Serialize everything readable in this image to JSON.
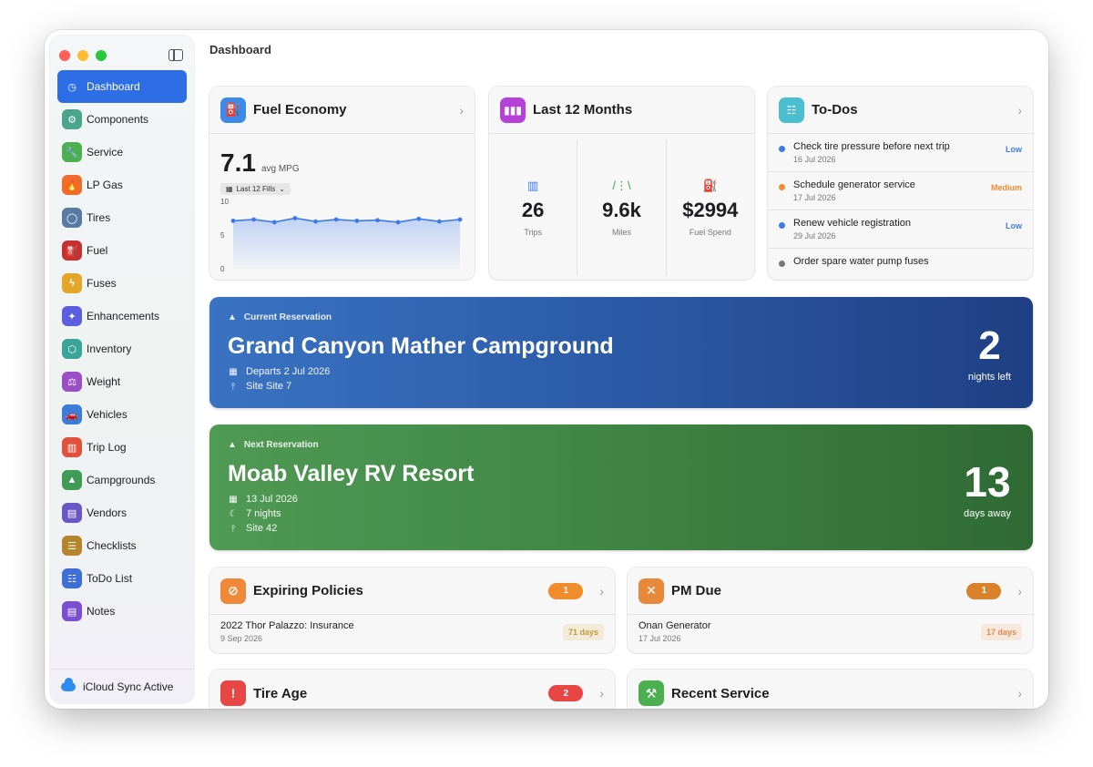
{
  "sidebar": {
    "items": [
      {
        "label": "Dashboard",
        "icon": "dashboard-icon",
        "color": "#2d6de6",
        "glyph": "◷"
      },
      {
        "label": "Components",
        "icon": "gear-icon",
        "color": "#4aa58c",
        "glyph": "⚙"
      },
      {
        "label": "Service",
        "icon": "wrench-icon",
        "color": "#4caf50",
        "glyph": "🔧"
      },
      {
        "label": "LP Gas",
        "icon": "flame-icon",
        "color": "#ef6c2b",
        "glyph": "🔥"
      },
      {
        "label": "Tires",
        "icon": "tire-icon",
        "color": "#5a7aa6",
        "glyph": "◯"
      },
      {
        "label": "Fuel",
        "icon": "fuel-pump-icon",
        "color": "#c53030",
        "glyph": "⛽"
      },
      {
        "label": "Fuses",
        "icon": "bolt-icon",
        "color": "#e3a62b",
        "glyph": "ϟ"
      },
      {
        "label": "Enhancements",
        "icon": "sparkles-icon",
        "color": "#5b5fdf",
        "glyph": "✦"
      },
      {
        "label": "Inventory",
        "icon": "box-icon",
        "color": "#3aa39a",
        "glyph": "⬡"
      },
      {
        "label": "Weight",
        "icon": "scale-icon",
        "color": "#9b4fc6",
        "glyph": "⚖"
      },
      {
        "label": "Vehicles",
        "icon": "car-icon",
        "color": "#3d7bd8",
        "glyph": "🚗"
      },
      {
        "label": "Trip Log",
        "icon": "map-icon",
        "color": "#e0523d",
        "glyph": "▥"
      },
      {
        "label": "Campgrounds",
        "icon": "tent-icon",
        "color": "#3f9b55",
        "glyph": "▲"
      },
      {
        "label": "Vendors",
        "icon": "store-icon",
        "color": "#6b56c8",
        "glyph": "▤"
      },
      {
        "label": "Checklists",
        "icon": "clipboard-icon",
        "color": "#b7842e",
        "glyph": "☰"
      },
      {
        "label": "ToDo List",
        "icon": "list-icon",
        "color": "#3f6fd6",
        "glyph": "☷"
      },
      {
        "label": "Notes",
        "icon": "note-icon",
        "color": "#7a4fd0",
        "glyph": "▤"
      }
    ],
    "sync_label": "iCloud Sync Active"
  },
  "page_title": "Dashboard",
  "fuel": {
    "title": "Fuel Economy",
    "value": "7.1",
    "unit": "avg MPG",
    "filter": "Last 12 Fills",
    "color": "#3c8be8",
    "chart_data": {
      "type": "area",
      "values": [
        7.1,
        7.3,
        6.9,
        7.5,
        7.0,
        7.3,
        7.1,
        7.2,
        6.9,
        7.4,
        7.0,
        7.3
      ],
      "ylim": [
        0,
        10
      ],
      "yticks": [
        "10",
        "5",
        "0"
      ],
      "grid": false
    }
  },
  "months": {
    "title": "Last 12 Months",
    "color": "#b442d8",
    "stats": [
      {
        "value": "26",
        "label": "Trips",
        "icon": "map-icon",
        "glyph": "▥",
        "color": "#3c7be8"
      },
      {
        "value": "9.6k",
        "label": "Miles",
        "icon": "road-icon",
        "glyph": "/⋮\\",
        "color": "#3aa84a"
      },
      {
        "value": "$2994",
        "label": "Fuel Spend",
        "icon": "fuel-pump-icon",
        "glyph": "⛽",
        "color": "#ef8c2b"
      }
    ]
  },
  "todos": {
    "title": "To-Dos",
    "color": "#4bbfcf",
    "items": [
      {
        "title": "Check tire pressure before next trip",
        "date": "16 Jul 2026",
        "priority": "Low",
        "color": "#3c7be8"
      },
      {
        "title": "Schedule generator service",
        "date": "17 Jul 2026",
        "priority": "Medium",
        "color": "#ef8c2b"
      },
      {
        "title": "Renew vehicle registration",
        "date": "29 Jul 2026",
        "priority": "Low",
        "color": "#3c7be8"
      },
      {
        "title": "Order spare water pump fuses",
        "date": "",
        "priority": "",
        "color": "#777777"
      }
    ]
  },
  "current": {
    "kicker": "Current Reservation",
    "name": "Grand Canyon Mather Campground",
    "departs": "Departs 2 Jul 2026",
    "site": "Site Site 7",
    "count": "2",
    "count_label": "nights left"
  },
  "next": {
    "kicker": "Next Reservation",
    "name": "Moab Valley RV Resort",
    "date": "13 Jul 2026",
    "nights": "7 nights",
    "site": "Site 42",
    "count": "13",
    "count_label": "days away"
  },
  "policies": {
    "title": "Expiring Policies",
    "badge": "1",
    "item": "2022 Thor Palazzo: Insurance",
    "date": "9 Sep 2026",
    "days": "71 days",
    "color": "#f0883a"
  },
  "pm": {
    "title": "PM Due",
    "badge": "1",
    "item": "Onan Generator",
    "date": "17 Jul 2026",
    "days": "17 days",
    "color": "#e8883a"
  },
  "tire_age": {
    "title": "Tire Age",
    "badge": "2",
    "color": "#e84545"
  },
  "recent_service": {
    "title": "Recent Service",
    "color": "#4caf50"
  }
}
